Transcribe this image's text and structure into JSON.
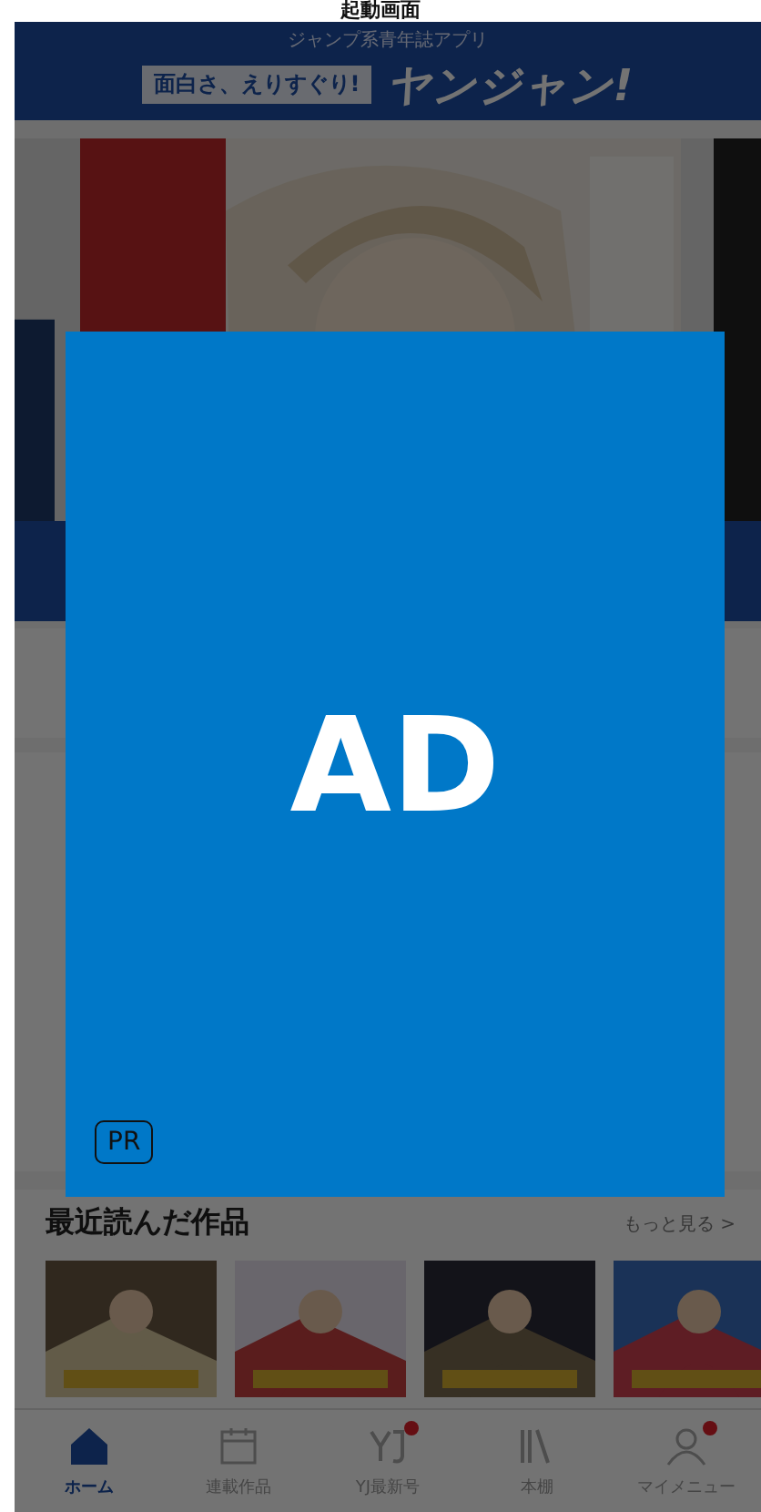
{
  "page_title": "起動画面",
  "header": {
    "tagline": "ジャンプ系青年誌アプリ",
    "catchphrase": "面白さ、えりすぐり!",
    "logo": "ヤンジャン!"
  },
  "recent": {
    "title": "最近読んだ作品",
    "more_link": "もっと見る >"
  },
  "nav": [
    {
      "label": "ホーム",
      "selected": true,
      "badge": false
    },
    {
      "label": "連載作品",
      "selected": false,
      "badge": false
    },
    {
      "label": "YJ最新号",
      "selected": false,
      "badge": true
    },
    {
      "label": "本棚",
      "selected": false,
      "badge": false
    },
    {
      "label": "マイメニュー",
      "selected": false,
      "badge": true
    }
  ],
  "ad": {
    "label": "AD",
    "badge": "PR"
  }
}
